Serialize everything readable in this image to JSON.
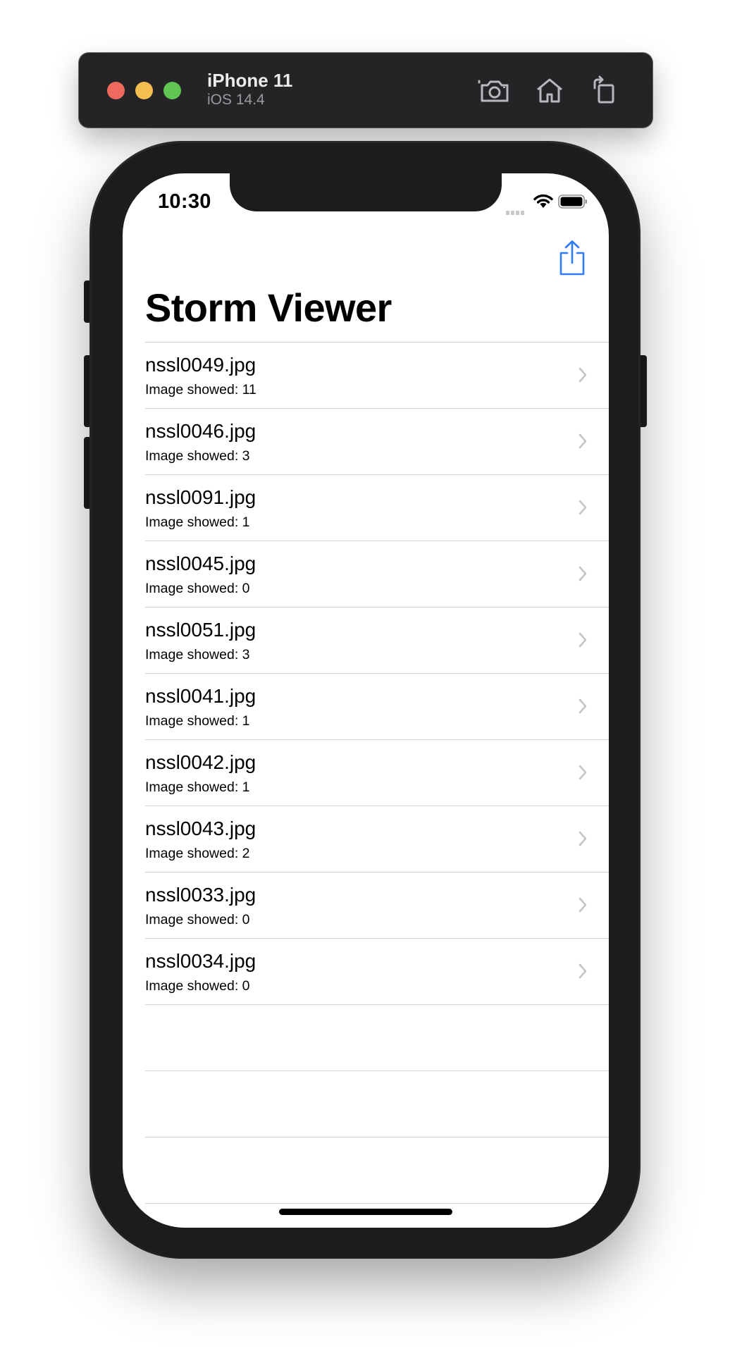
{
  "simulator": {
    "device": "iPhone 11",
    "os": "iOS 14.4",
    "icons": [
      "camera-icon",
      "home-icon",
      "rotate-icon"
    ]
  },
  "status_bar": {
    "time": "10:30"
  },
  "nav": {
    "title": "Storm Viewer",
    "share_icon": "share-icon",
    "accent_color": "#2f7cf6"
  },
  "rows": [
    {
      "title": "nssl0049.jpg",
      "subtitle": "Image showed: 11"
    },
    {
      "title": "nssl0046.jpg",
      "subtitle": "Image showed: 3"
    },
    {
      "title": "nssl0091.jpg",
      "subtitle": "Image showed: 1"
    },
    {
      "title": "nssl0045.jpg",
      "subtitle": "Image showed: 0"
    },
    {
      "title": "nssl0051.jpg",
      "subtitle": "Image showed: 3"
    },
    {
      "title": "nssl0041.jpg",
      "subtitle": "Image showed: 1"
    },
    {
      "title": "nssl0042.jpg",
      "subtitle": "Image showed: 1"
    },
    {
      "title": "nssl0043.jpg",
      "subtitle": "Image showed: 2"
    },
    {
      "title": "nssl0033.jpg",
      "subtitle": "Image showed: 0"
    },
    {
      "title": "nssl0034.jpg",
      "subtitle": "Image showed: 0"
    }
  ]
}
